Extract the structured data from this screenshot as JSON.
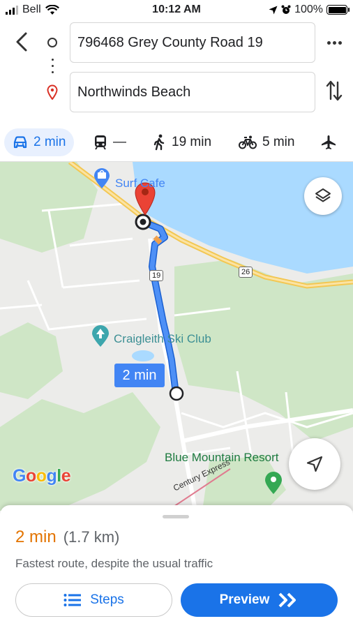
{
  "status_bar": {
    "carrier": "Bell",
    "time": "10:12 AM",
    "battery": "100%",
    "icons": [
      "signal-icon",
      "wifi-icon",
      "location-arrow-icon",
      "alarm-icon",
      "battery-icon"
    ]
  },
  "directions": {
    "origin": "796468 Grey County Road 19",
    "destination": "Northwinds Beach"
  },
  "modes": [
    {
      "icon": "car-icon",
      "label": "2 min",
      "active": true
    },
    {
      "icon": "transit-icon",
      "label": "—",
      "active": false
    },
    {
      "icon": "walk-icon",
      "label": "19 min",
      "active": false
    },
    {
      "icon": "bike-icon",
      "label": "5 min",
      "active": false
    },
    {
      "icon": "plane-icon",
      "label": "",
      "active": false
    }
  ],
  "map": {
    "labels": {
      "surf": "Surf Cafe",
      "craigleith": "Craigleith Ski Club",
      "blue_mountain": "Blue Mountain Resort",
      "century": "Century Express"
    },
    "route_shields": [
      "19",
      "26"
    ],
    "route_time": "2 min",
    "logo": "Google",
    "colors": {
      "water": "#aadaff",
      "route": "#4285f4",
      "destination_pin": "#ea4335",
      "parks": "#cde8c8",
      "highway": "#f7d27a"
    }
  },
  "sheet": {
    "duration": "2 min",
    "distance": "(1.7 km)",
    "note": "Fastest route, despite the usual traffic",
    "steps_label": "Steps",
    "preview_label": "Preview"
  }
}
